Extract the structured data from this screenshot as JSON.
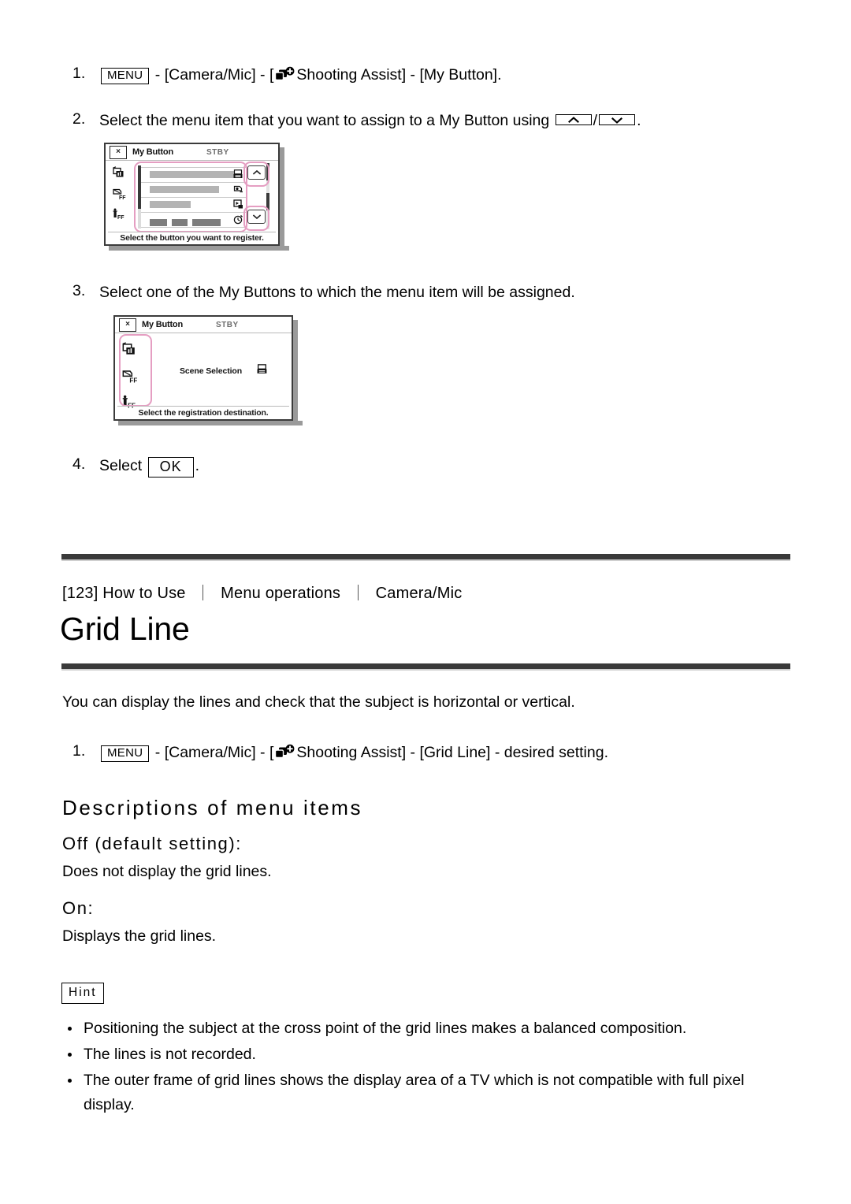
{
  "document": {
    "title": "Grid Line"
  },
  "my_button_steps": [
    {
      "num": "1.",
      "prefix": "",
      "menu_key": "MENU",
      "text_after_key": " - [Camera/Mic] - [",
      "icon": "shooting-assist-icon",
      "text_tail": "Shooting Assist] - [My Button]."
    },
    {
      "num": "2.",
      "text_lead": "Select the menu item that you want to assign to a My Button using ",
      "key_up": "chevron-up-icon",
      "separator": "/",
      "key_down": "chevron-down-icon",
      "text_tail": "."
    },
    {
      "num": "3.",
      "text": "Select one of the My Buttons to which the menu item will be assigned."
    },
    {
      "num": "4.",
      "text_lead": "Select ",
      "ok_key": "OK",
      "text_tail": "."
    }
  ],
  "screenshot_one": {
    "name": "My Button",
    "close_label": "×",
    "status": "STBY",
    "caption": "Select the button you want to register.",
    "side_icons": [
      "picture-effect-icon",
      "face-detection-off-icon",
      "flash-off-icon"
    ],
    "rows": [
      {
        "label_width": 108,
        "icon": "print-icon"
      },
      {
        "label_width": 88,
        "icon": "face-icon"
      },
      {
        "label_width": 52,
        "icon": "playback-icon"
      },
      {
        "label_width": 92,
        "icon": "timer-icon"
      }
    ],
    "nav_up": "chevron-up-icon",
    "nav_down": "chevron-down-icon"
  },
  "screenshot_two": {
    "name": "My Button",
    "close_label": "×",
    "status": "STBY",
    "caption": "Select the registration destination.",
    "side_icons": [
      "picture-effect-icon",
      "face-detection-off-icon",
      "flash-off-icon"
    ],
    "item_label": "Scene Selection",
    "item_icon": "print-icon"
  },
  "breadcrumb": {
    "index": "[123] How to Use",
    "section": "Menu operations",
    "subsection": "Camera/Mic"
  },
  "grid_line": {
    "intro": "You can display the lines and check that the subject is horizontal or vertical.",
    "step": {
      "num": "1.",
      "menu_key": "MENU",
      "text_after_key": " - [Camera/Mic] - [",
      "icon": "shooting-assist-icon",
      "text_tail": "Shooting Assist] - [Grid Line] - desired setting."
    },
    "descriptions_heading": "Descriptions of menu items",
    "options": [
      {
        "name": "Off (default setting):",
        "desc": "Does not display the grid lines."
      },
      {
        "name": "On:",
        "desc": "Displays the grid lines."
      }
    ],
    "hint_label": "Hint",
    "hints": [
      "Positioning the subject at the cross point of the grid lines makes a balanced composition.",
      "The lines is not recorded.",
      "The outer frame of grid lines shows the display area of a TV which is not compatible with full pixel display."
    ]
  },
  "colors": {
    "rule": "#3a3a3a",
    "highlight": "#e59ec2",
    "text": "#000000",
    "lcd_gray": "#b4b4b4"
  }
}
